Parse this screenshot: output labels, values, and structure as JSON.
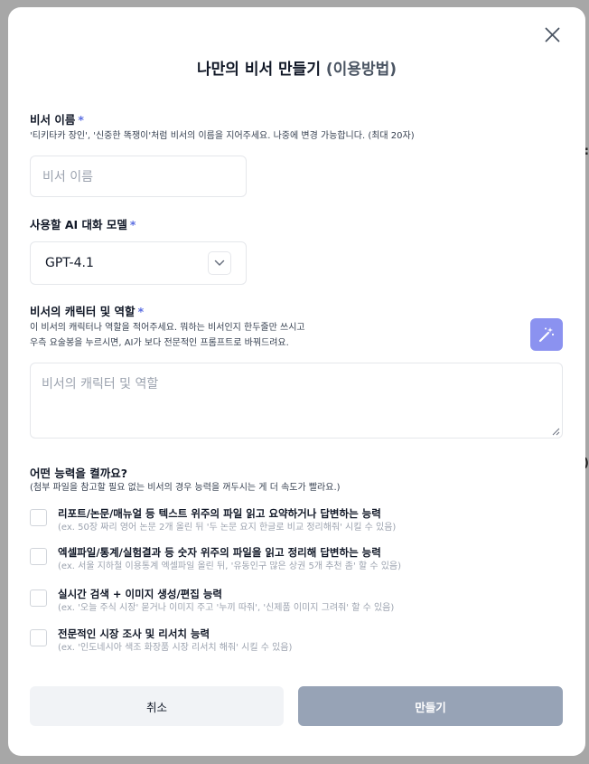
{
  "dialog": {
    "title": "나만의 비서 만들기",
    "title_link": "(이용방법)"
  },
  "assistant_name": {
    "label": "비서 이름",
    "required_mark": "*",
    "hint": "'티키타카 장인', '신중한 똑쟁이'처럼 비서의 이름을 지어주세요. 나중에 변경 가능합니다. (최대 20자)",
    "placeholder": "비서 이름"
  },
  "model": {
    "label": "사용할 AI 대화 모델",
    "required_mark": "*",
    "selected": "GPT-4.1"
  },
  "character": {
    "label": "비서의 캐릭터 및 역할",
    "required_mark": "*",
    "hint_line1": "이 비서의 캐릭터나 역할을 적어주세요. 뭐하는 비서인지 한두줄만 쓰시고",
    "hint_line2": "우측 요술봉을 누르시면, AI가 보다 전문적인 프롬프트로 바꿔드려요.",
    "placeholder": "비서의 캐릭터 및 역할"
  },
  "capabilities": {
    "heading": "어떤 능력을 켤까요?",
    "subheading": "(첨부 파일을 참고할 필요 없는 비서의 경우 능력을 꺼두시는 게 더 속도가 빨라요.)",
    "items": [
      {
        "label": "리포트/논문/매뉴얼 등 텍스트 위주의 파일 읽고 요약하거나 답변하는 능력",
        "example": "(ex. 50장 짜리 영어 논문 2개 올린 뒤 '두 논문 요지 한글로 비교 정리해줘' 시킬 수 있음)"
      },
      {
        "label": "엑셀파일/통계/실험결과 등 숫자 위주의 파일을 읽고 정리해 답변하는 능력",
        "example": "(ex. 서울 지하철 이용통계 엑셀파일 올린 뒤, '유동인구 많은 상권 5개 추천 좀' 할 수 있음)"
      },
      {
        "label": "실시간 검색 + 이미지 생성/편집 능력",
        "example": "(ex. '오늘 주식 시장' 묻거나 이미지 주고 '누끼 따줘', '신제품 이미지 그려줘' 할 수 있음)"
      },
      {
        "label": "전문적인 시장 조사 및 리서치 능력",
        "example": "(ex. '인도네시아 색조 화장품 시장 리서치 해줘' 시킬 수 있음)"
      }
    ]
  },
  "actions": {
    "cancel": "취소",
    "create": "만들기"
  },
  "colors": {
    "accent": "#5b6ee1",
    "magic_button": "#8b92f0",
    "create_button": "#97a3b6"
  }
}
